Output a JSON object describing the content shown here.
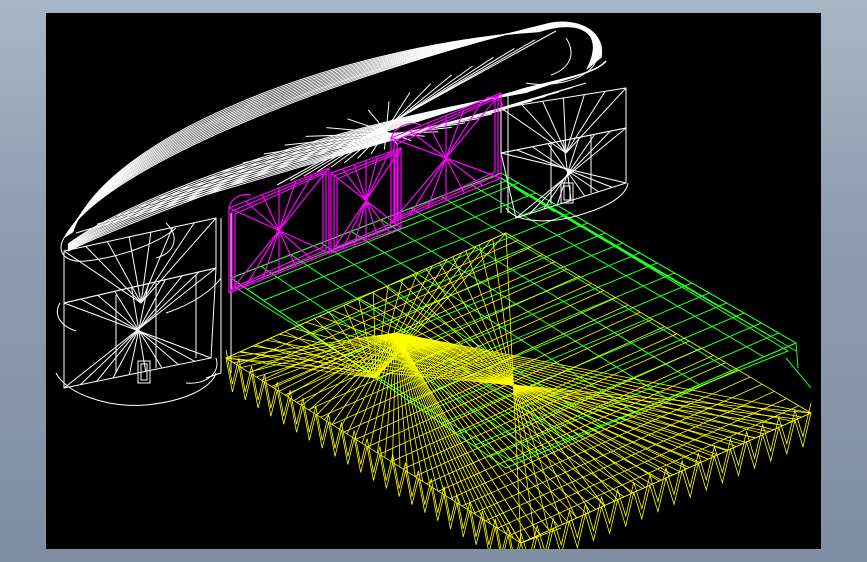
{
  "window": {
    "background": "#8e9db0"
  },
  "viewport": {
    "background": "#000000"
  },
  "drawing": {
    "subject": "bed-wireframe",
    "colors": {
      "headboard": "#ffffff",
      "panels": "#ff00ff",
      "mattress": "#ffff00",
      "frame": "#22ff22"
    }
  }
}
